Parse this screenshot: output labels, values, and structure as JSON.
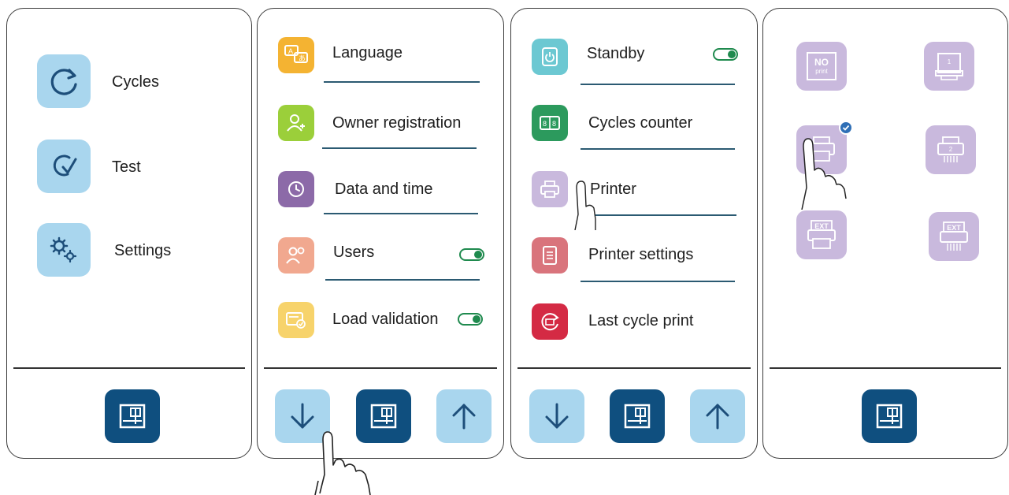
{
  "screen1": {
    "items": [
      {
        "label": "Cycles",
        "icon": "refresh-icon"
      },
      {
        "label": "Test",
        "icon": "test-icon"
      },
      {
        "label": "Settings",
        "icon": "gears-icon"
      }
    ],
    "home_icon": "home-icon"
  },
  "screen2": {
    "items": [
      {
        "label": "Language",
        "icon": "language-icon",
        "color": "#f4b332"
      },
      {
        "label": "Owner registration",
        "icon": "owner-icon",
        "color": "#9bcf3a"
      },
      {
        "label": "Data and time",
        "icon": "clock-icon",
        "color": "#8c6aa8"
      },
      {
        "label": "Users",
        "icon": "users-icon",
        "color": "#f1a88f",
        "toggle": true
      },
      {
        "label": "Load validation",
        "icon": "load-validation-icon",
        "color": "#f7d36b",
        "toggle": true
      }
    ]
  },
  "screen3": {
    "items": [
      {
        "label": "Standby",
        "icon": "standby-icon",
        "color": "#6cc8d2",
        "toggle": true
      },
      {
        "label": "Cycles counter",
        "icon": "counter-icon",
        "color": "#2c9a5d"
      },
      {
        "label": "Printer",
        "icon": "printer-icon",
        "color": "#c9b9dd"
      },
      {
        "label": "Printer settings",
        "icon": "printer-settings-icon",
        "color": "#d9747c"
      },
      {
        "label": "Last cycle print",
        "icon": "last-cycle-print-icon",
        "color": "#d42a44"
      }
    ]
  },
  "screen4": {
    "tiles": [
      {
        "icon_text_1": "NO",
        "icon_text_2": "print",
        "name": "no-print"
      },
      {
        "icon_text_1": "1",
        "name": "printer-1"
      },
      {
        "icon_text_1": "",
        "name": "printer-internal",
        "selected": true
      },
      {
        "icon_text_1": "2",
        "name": "printer-2"
      },
      {
        "icon_text_1": "EXT",
        "name": "external-printer-1"
      },
      {
        "icon_text_1": "EXT",
        "name": "external-printer-2"
      }
    ]
  },
  "colors": {
    "tile_blue": "#a9d6ee",
    "home_dark": "#0f4f7f",
    "printer_lilac": "#c9b9dd",
    "toggle_green": "#1f8a4e"
  }
}
